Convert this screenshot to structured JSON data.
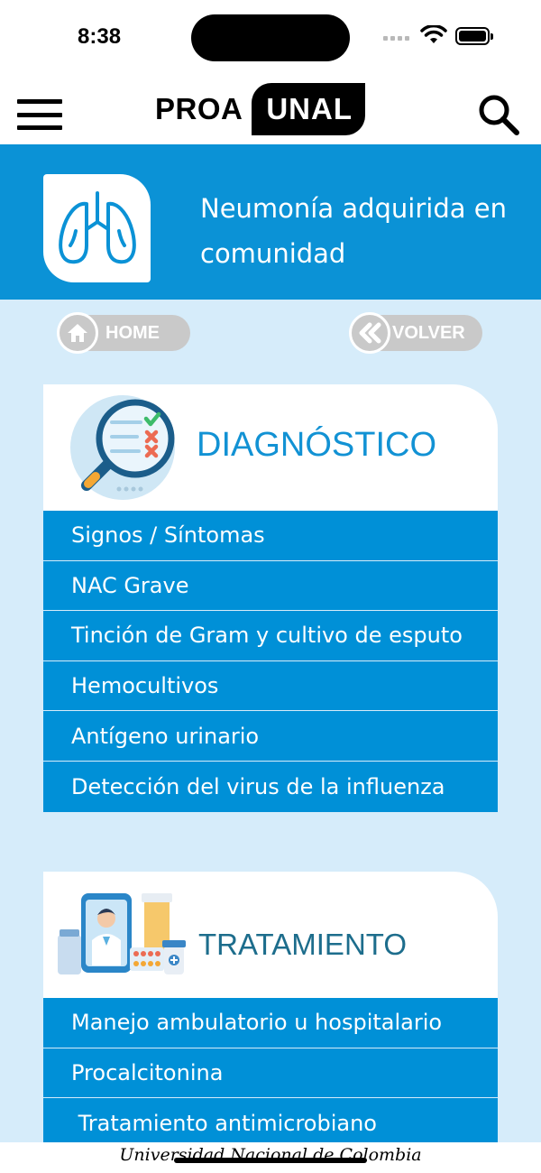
{
  "status_bar": {
    "time": "8:38"
  },
  "nav": {
    "logo_left": "PROA",
    "logo_right": "UNAL"
  },
  "hero": {
    "title": "Neumonía adquirida en comunidad",
    "icon": "lungs-icon"
  },
  "buttons": {
    "home_label": "HOME",
    "back_label": "VOLVER"
  },
  "diagnostico": {
    "title": "DIAGNÓSTICO",
    "items": [
      {
        "label": "Signos / Síntomas"
      },
      {
        "label": "NAC Grave"
      },
      {
        "label": "Tinción de Gram y cultivo de esputo"
      },
      {
        "label": "Hemocultivos"
      },
      {
        "label": "Antígeno urinario"
      },
      {
        "label": "Detección del virus de la influenza"
      }
    ]
  },
  "tratamiento": {
    "title": "TRATAMIENTO",
    "items": [
      {
        "label": "Manejo ambulatorio u hospitalario"
      },
      {
        "label": "Procalcitonina"
      },
      {
        "label": " Tratamiento antimicrobiano"
      }
    ]
  },
  "footer": {
    "text": "Universidad Nacional de Colombia"
  },
  "colors": {
    "primary": "#0090d7",
    "background": "#d6ecfa",
    "button_gray": "#c9c9c9"
  }
}
